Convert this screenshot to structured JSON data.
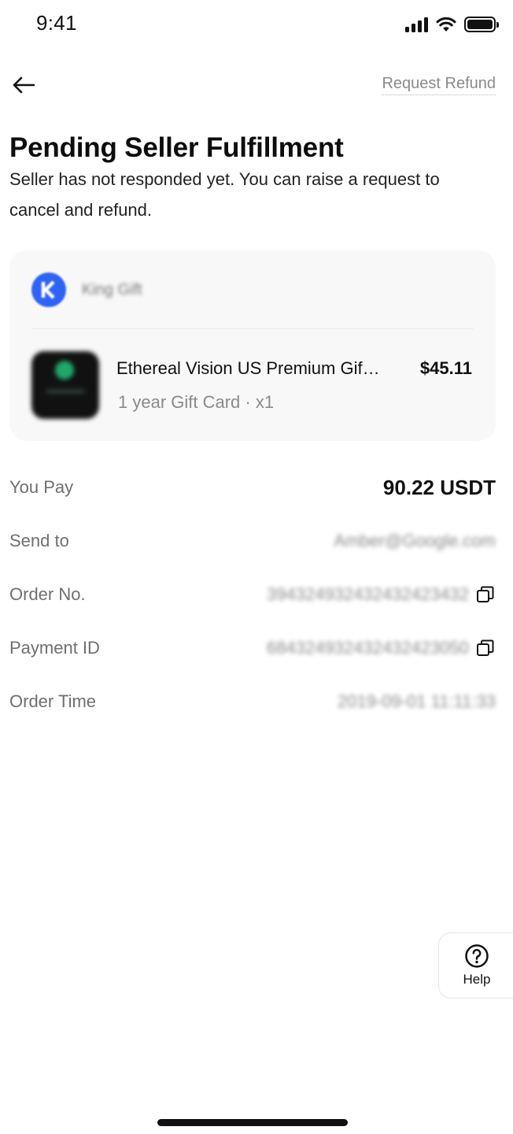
{
  "status_bar": {
    "time": "9:41"
  },
  "nav": {
    "back_icon": "arrow-left-icon",
    "request_refund_label": "Request Refund"
  },
  "header": {
    "title": "Pending Seller Fulfillment",
    "subtitle": "Seller has not responded yet. You can raise a request to cancel and refund."
  },
  "order_card": {
    "seller": {
      "name": "King Gift",
      "logo_icon": "seller-k-logo-icon",
      "logo_color": "#2f63f5"
    },
    "product": {
      "name": "Ethereal Vision US Premium Gift Card",
      "price": "$45.11",
      "meta": "1 year Gift Card · x1"
    }
  },
  "details": [
    {
      "label": "You Pay",
      "value": "90.22 USDT",
      "copy": false
    },
    {
      "label": "Send to",
      "value": "Amber@Google.com",
      "copy": false
    },
    {
      "label": "Order No.",
      "value": "394324932432432423432",
      "copy": true
    },
    {
      "label": "Payment ID",
      "value": "684324932432432423050",
      "copy": true
    },
    {
      "label": "Order Time",
      "value": "2019-09-01 11:11:33",
      "copy": false
    }
  ],
  "help": {
    "label": "Help",
    "icon": "question-circle-icon"
  },
  "colors": {
    "accent": "#2f63f5",
    "background": "#ffffff",
    "card": "#f8f8f8",
    "muted_text": "#8a8a8a"
  }
}
